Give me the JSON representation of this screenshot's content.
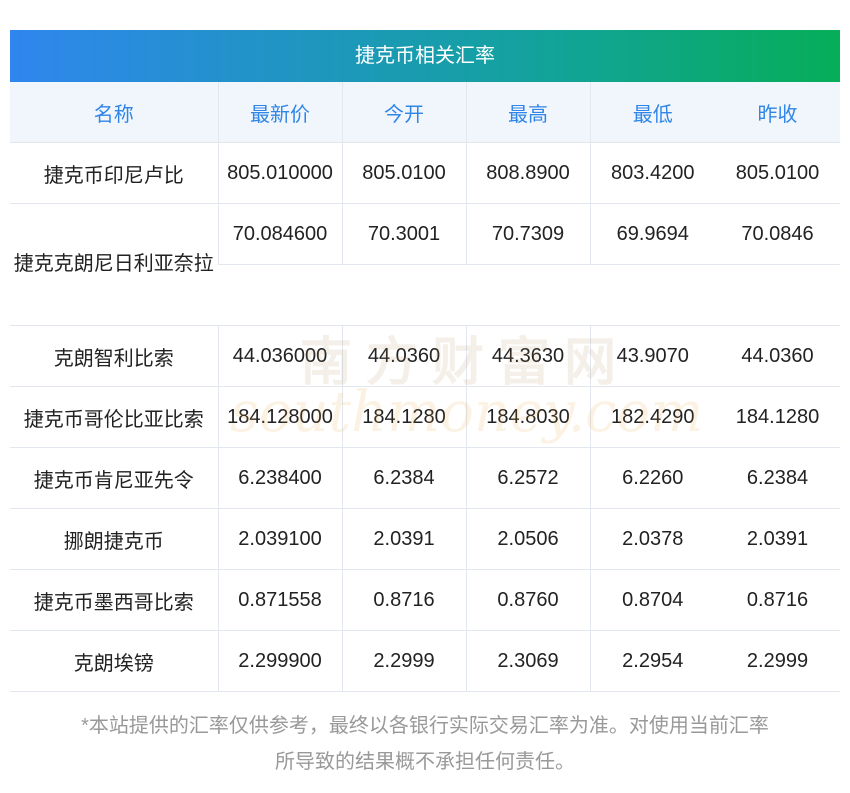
{
  "title": "捷克币相关汇率",
  "headers": [
    "名称",
    "最新价",
    "今开",
    "最高",
    "最低",
    "昨收"
  ],
  "rows": [
    [
      "捷克币印尼卢比",
      "805.010000",
      "805.0100",
      "808.8900",
      "803.4200",
      "805.0100"
    ],
    [
      "捷克克朗尼日利亚奈拉",
      "70.084600",
      "70.3001",
      "70.7309",
      "69.9694",
      "70.0846"
    ],
    [
      "克朗智利比索",
      "44.036000",
      "44.0360",
      "44.3630",
      "43.9070",
      "44.0360"
    ],
    [
      "捷克币哥伦比亚比索",
      "184.128000",
      "184.1280",
      "184.8030",
      "182.4290",
      "184.1280"
    ],
    [
      "捷克币肯尼亚先令",
      "6.238400",
      "6.2384",
      "6.2572",
      "6.2260",
      "6.2384"
    ],
    [
      "挪朗捷克币",
      "2.039100",
      "2.0391",
      "2.0506",
      "2.0378",
      "2.0391"
    ],
    [
      "捷克币墨西哥比索",
      "0.871558",
      "0.8716",
      "0.8760",
      "0.8704",
      "0.8716"
    ],
    [
      "克朗埃镑",
      "2.299900",
      "2.2999",
      "2.3069",
      "2.2954",
      "2.2999"
    ]
  ],
  "watermark": {
    "cn": "南方财富网",
    "en": "southmoney.com"
  },
  "note_line1": "*本站提供的汇率仅供参考，最终以各银行实际交易汇率为准。对使用当前汇率",
  "note_line2": "所导致的结果概不承担任何责任。"
}
